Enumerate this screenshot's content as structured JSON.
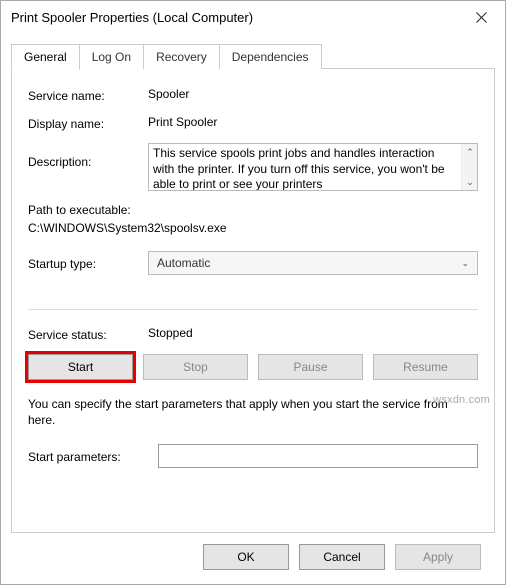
{
  "window": {
    "title": "Print Spooler Properties (Local Computer)"
  },
  "tabs": {
    "general": "General",
    "logon": "Log On",
    "recovery": "Recovery",
    "dependencies": "Dependencies"
  },
  "labels": {
    "service_name": "Service name:",
    "display_name": "Display name:",
    "description": "Description:",
    "path_label": "Path to executable:",
    "startup_type": "Startup type:",
    "service_status": "Service status:",
    "start_params": "Start parameters:"
  },
  "values": {
    "service_name": "Spooler",
    "display_name": "Print Spooler",
    "description": "This service spools print jobs and handles interaction with the printer.  If you turn off this service, you won't be able to print or see your printers",
    "path": "C:\\WINDOWS\\System32\\spoolsv.exe",
    "startup_type": "Automatic",
    "service_status": "Stopped",
    "start_params": ""
  },
  "buttons": {
    "start": "Start",
    "stop": "Stop",
    "pause": "Pause",
    "resume": "Resume",
    "ok": "OK",
    "cancel": "Cancel",
    "apply": "Apply"
  },
  "help_text": "You can specify the start parameters that apply when you start the service from here.",
  "watermark": "wsxdn.com"
}
